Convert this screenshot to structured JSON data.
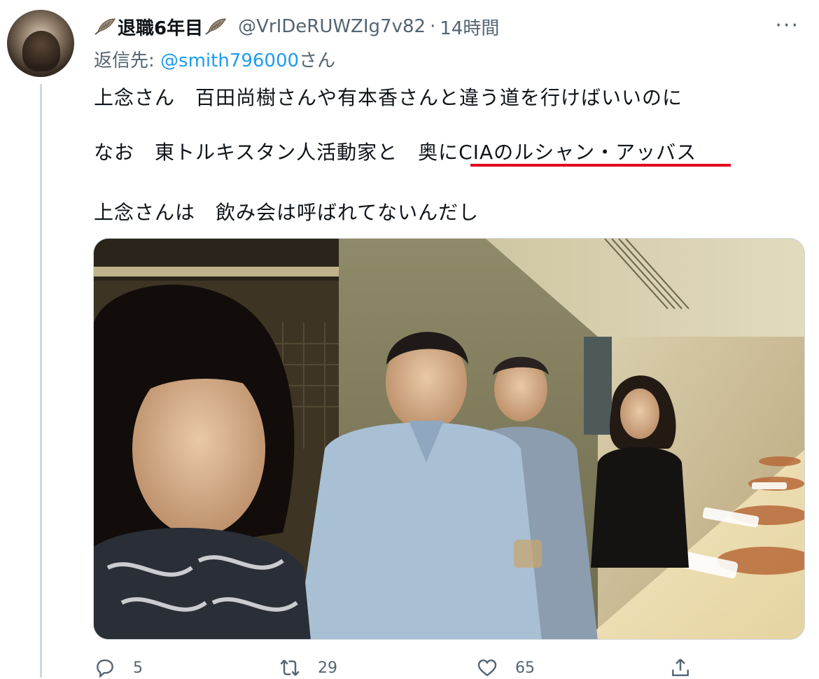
{
  "tweet": {
    "display_name": "退職6年目",
    "handle": "@VrIDeRUWZIg7v82",
    "separator": "·",
    "time": "14時間",
    "more_label": "···",
    "reply_prefix": "返信先: ",
    "reply_mention": "@smith796000",
    "reply_suffix": "さん",
    "lines": [
      "上念さん　百田尚樹さんや有本香さんと違う道を行けばいいのに",
      "なお　東トルキスタン人活動家と　奥にCIAのルシャン・アッバス",
      "上念さんは　飲み会は呼ばれてないんだし"
    ],
    "highlight_color": "#e1001a",
    "mention_color": "#1d9bf0",
    "photo_description_icon": "restaurant-photo"
  },
  "actions": {
    "reply_count": "5",
    "retweet_count": "29",
    "like_count": "65",
    "reply_icon": "reply-icon",
    "retweet_icon": "retweet-icon",
    "like_icon": "heart-icon",
    "share_icon": "share-icon"
  }
}
